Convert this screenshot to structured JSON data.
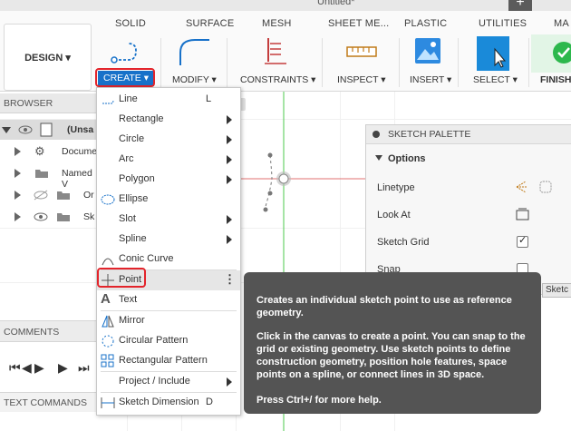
{
  "window": {
    "doc_title": "Untitled*"
  },
  "tabs": [
    "SOLID",
    "SURFACE",
    "MESH",
    "SHEET ME...",
    "PLASTIC",
    "UTILITIES",
    "MA"
  ],
  "toolbar": {
    "design_label": "DESIGN ▾",
    "create_label": "CREATE ▾",
    "modify_label": "MODIFY ▾",
    "constraints_label": "CONSTRAINTS ▾",
    "inspect_label": "INSPECT ▾",
    "insert_label": "INSERT ▾",
    "select_label": "SELECT ▾",
    "finish_label": "FINISH"
  },
  "browser": {
    "title": "BROWSER",
    "items": [
      {
        "label": "(Unsa"
      },
      {
        "label": "Docume"
      },
      {
        "label": "Named V"
      },
      {
        "label": "Or"
      },
      {
        "label": "Sk"
      }
    ]
  },
  "comments": {
    "title": "COMMENTS"
  },
  "text_commands": {
    "title": "TEXT COMMANDS"
  },
  "create_menu": {
    "items": [
      {
        "label": "Line",
        "shortcut": "L"
      },
      {
        "label": "Rectangle"
      },
      {
        "label": "Circle"
      },
      {
        "label": "Arc"
      },
      {
        "label": "Polygon"
      },
      {
        "label": "Ellipse"
      },
      {
        "label": "Slot"
      },
      {
        "label": "Spline"
      },
      {
        "label": "Conic Curve"
      },
      {
        "label": "Point"
      },
      {
        "label": "Text"
      },
      {
        "label": "Mirror"
      },
      {
        "label": "Circular Pattern"
      },
      {
        "label": "Rectangular Pattern"
      },
      {
        "label": "Project / Include"
      },
      {
        "label": "Sketch Dimension",
        "shortcut": "D"
      }
    ]
  },
  "sketch_palette": {
    "title": "SKETCH PALETTE",
    "section": "Options",
    "rows": [
      {
        "label": "Linetype"
      },
      {
        "label": "Look At"
      },
      {
        "label": "Sketch Grid",
        "checked": true
      },
      {
        "label": "Snap",
        "checked": false
      }
    ],
    "partial_button": "Sketc"
  },
  "tooltip": {
    "p1": "Creates an individual sketch point to use as reference geometry.",
    "p2": "Click in the canvas to create a point. You can snap to the grid or existing geometry. Use sketch points to define construction geometry, position hole features, space points on a spline, or connect lines in 3D space.",
    "p3": "Press Ctrl+/ for more help."
  },
  "colors": {
    "accent": "#1771c9",
    "highlight": "#e3242b",
    "finish_green": "#2db84d",
    "tooltip_bg": "#545454"
  }
}
